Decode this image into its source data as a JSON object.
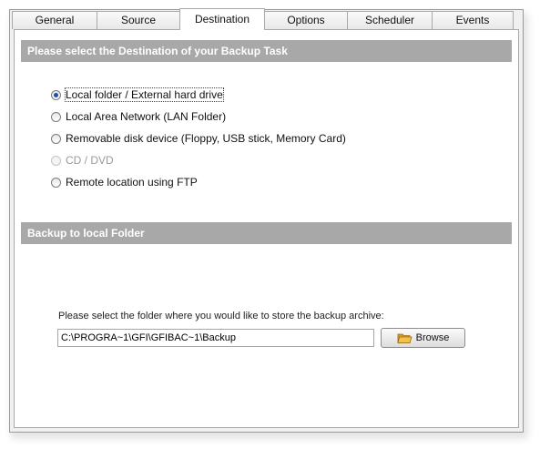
{
  "tabs": [
    {
      "label": "General"
    },
    {
      "label": "Source"
    },
    {
      "label": "Destination"
    },
    {
      "label": "Options"
    },
    {
      "label": "Scheduler"
    },
    {
      "label": "Events"
    }
  ],
  "active_tab": "Destination",
  "destination_section": {
    "title": "Please select the Destination of your Backup Task",
    "options": [
      {
        "label": "Local folder / External hard drive",
        "selected": true,
        "enabled": true
      },
      {
        "label": "Local Area Network (LAN Folder)",
        "selected": false,
        "enabled": true
      },
      {
        "label": "Removable disk device (Floppy, USB stick, Memory Card)",
        "selected": false,
        "enabled": true
      },
      {
        "label": "CD / DVD",
        "selected": false,
        "enabled": false
      },
      {
        "label": "Remote location using FTP",
        "selected": false,
        "enabled": true
      }
    ]
  },
  "local_folder_section": {
    "title": "Backup to local Folder",
    "prompt": "Please select the folder where you would like to store the backup archive:",
    "path_value": "C:\\PROGRA~1\\GFI\\GFIBAC~1\\Backup",
    "browse_label": "Browse",
    "browse_icon": "folder-icon"
  },
  "colors": {
    "header_bg": "#a8a8a8",
    "radio_dot": "#1f4fa8",
    "folder_icon": "#f0b030"
  }
}
